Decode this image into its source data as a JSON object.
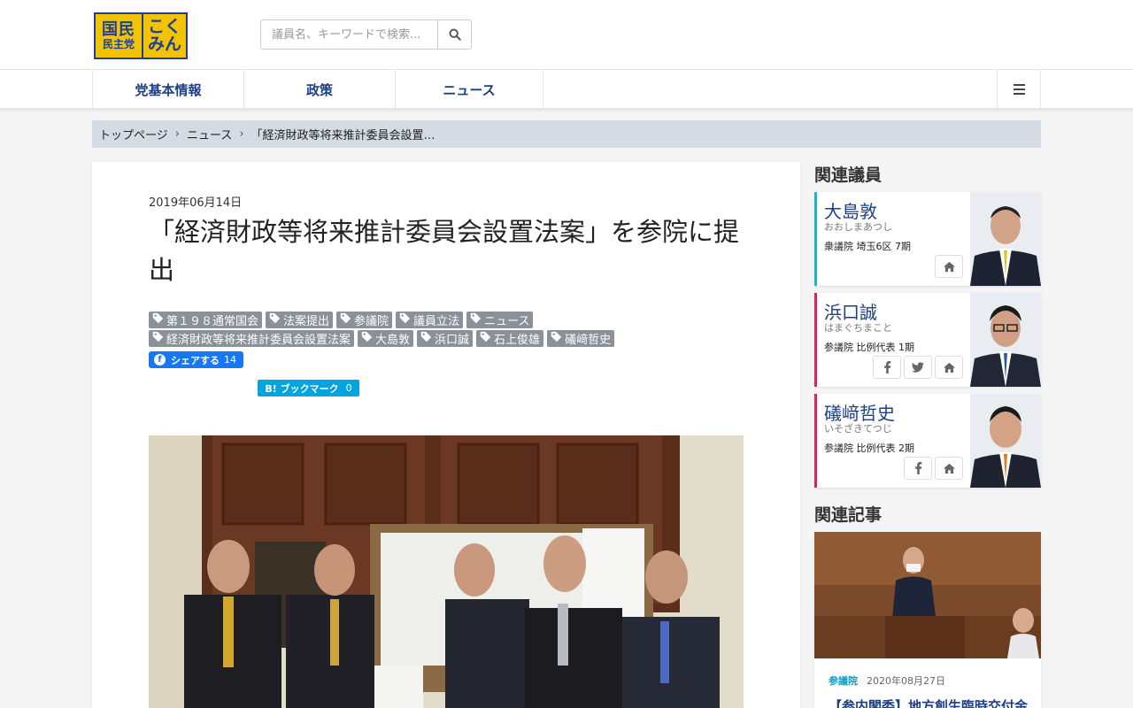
{
  "brand": {
    "logo_left_top": "国民",
    "logo_left_bottom": "民主党",
    "logo_right_top": "こく",
    "logo_right_bottom": "みん"
  },
  "search": {
    "placeholder": "議員名、キーワードで検索..."
  },
  "nav": {
    "items": [
      "党基本情報",
      "政策",
      "ニュース"
    ]
  },
  "breadcrumb": [
    "トップページ",
    "ニュース",
    "「経済財政等将来推計委員会設置…"
  ],
  "article": {
    "date": "2019年06月14日",
    "title": "「経済財政等将来推計委員会設置法案」を参院に提出",
    "tags": [
      "第１９８通常国会",
      "法案提出",
      "参議院",
      "議員立法",
      "ニュース",
      "経済財政等将来推計委員会設置法案",
      "大島敦",
      "浜口誠",
      "石上俊雄",
      "礒﨑哲史"
    ],
    "share_label": "シェアする",
    "share_count": "14",
    "hatena_label": "B! ブックマーク",
    "hatena_count": "0"
  },
  "sidebar": {
    "members_heading": "関連議員",
    "members": [
      {
        "name": "大島敦",
        "kana": "おおしまあつし",
        "info": "衆議院 埼玉6区 7期",
        "color": "#1ab5c6",
        "buttons": [
          "home"
        ]
      },
      {
        "name": "浜口誠",
        "kana": "はまぐちまこと",
        "info": "参議院 比例代表 1期",
        "color": "#d6245c",
        "buttons": [
          "facebook",
          "twitter",
          "home"
        ]
      },
      {
        "name": "礒﨑哲史",
        "kana": "いそざきてつじ",
        "info": "参議院 比例代表 2期",
        "color": "#d6245c",
        "buttons": [
          "facebook",
          "home"
        ]
      }
    ],
    "articles_heading": "関連記事",
    "article": {
      "house": "参議院",
      "date": "2020年08月27日",
      "title": "【参内閣委】地方創生臨時交付金"
    }
  },
  "colors": {
    "brand_blue": "#1b3f9a",
    "brand_yellow": "#f3c300",
    "nav_text": "#1d3f86",
    "tag_bg": "#8a9199"
  }
}
